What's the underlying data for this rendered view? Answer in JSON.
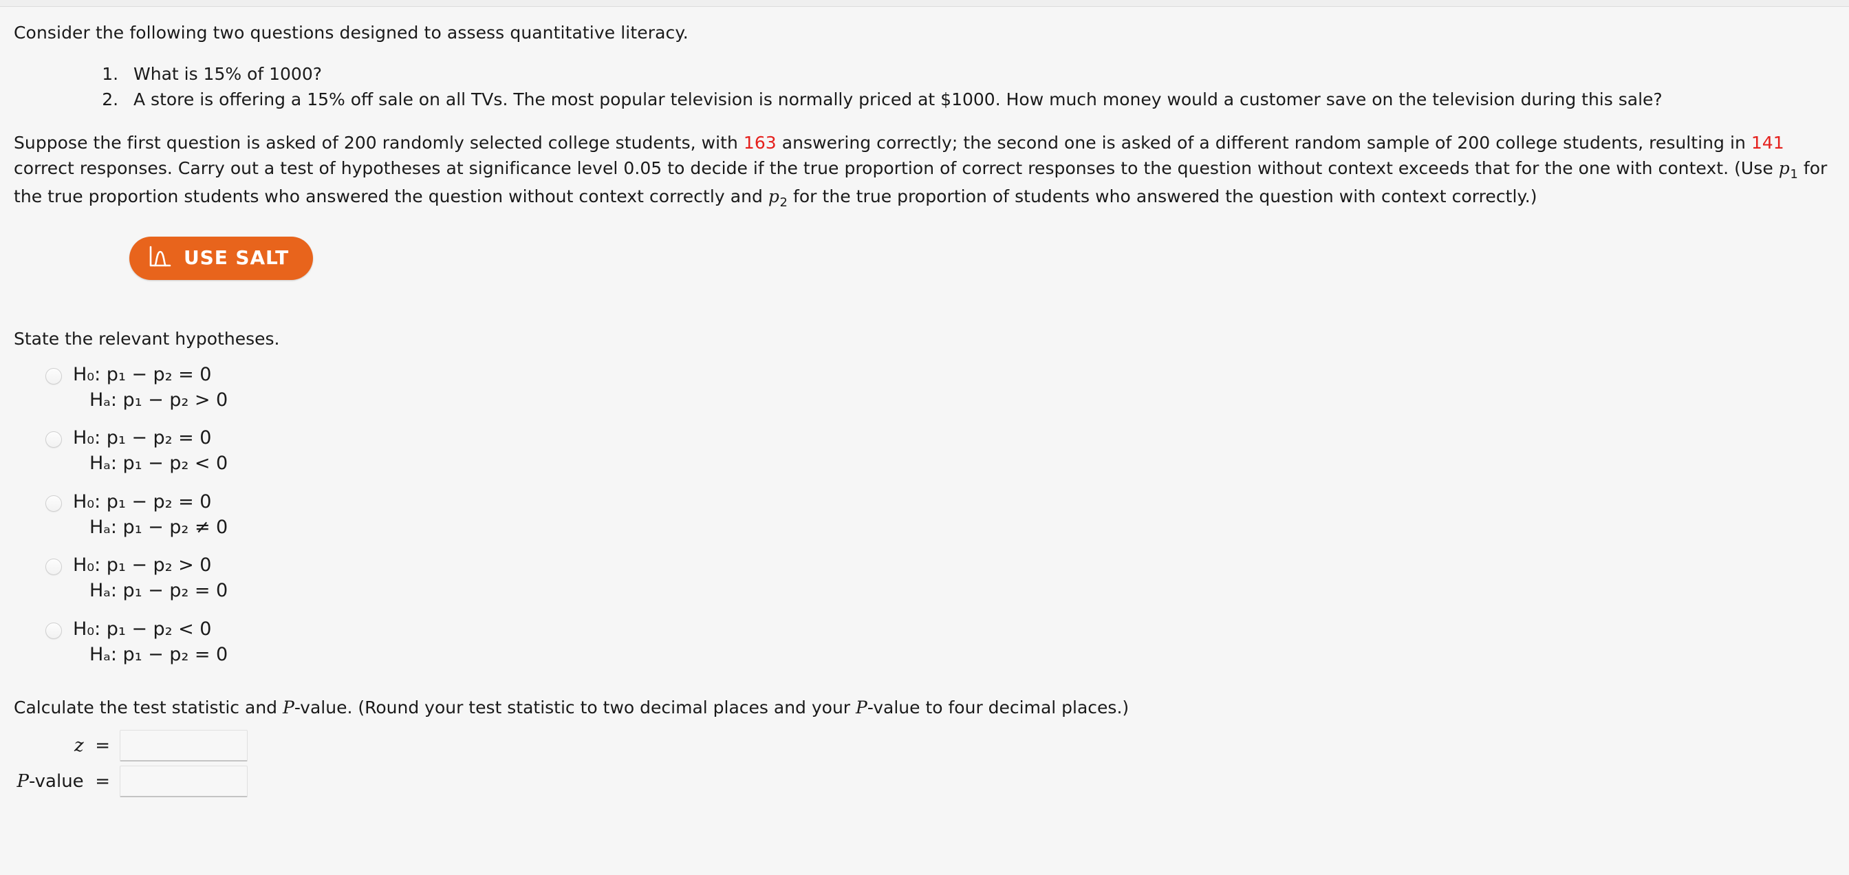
{
  "intro": "Consider the following two questions designed to assess quantitative literacy.",
  "questions": [
    "What is 15% of 1000?",
    "A store is offering a 15% off sale on all TVs. The most popular television is normally priced at $1000. How much money would a customer save on the television during this sale?"
  ],
  "problem": {
    "part1": "Suppose the first question is asked of 200 randomly selected college students, with ",
    "n1_correct": "163",
    "part2": " answering correctly; the second one is asked of a different random sample of 200 college students, resulting in ",
    "n2_correct": "141",
    "part3": " correct responses. Carry out a test of hypotheses at significance level 0.05 to decide if the true proportion of correct responses to the question without context exceeds that for the one with context. (Use ",
    "var1": "p",
    "var1_sub": "1",
    "part4": " for the true proportion students who answered the question without context correctly and ",
    "var2": "p",
    "var2_sub": "2",
    "part5": " for the true proportion of students who answered the question with context correctly.)"
  },
  "salt": {
    "label": "USE SALT",
    "icon": "distribution-curve-icon",
    "color": "#e8641c"
  },
  "hypotheses": {
    "prompt": "State the relevant hypotheses.",
    "options": [
      {
        "null": "H₀: p₁ − p₂ = 0",
        "alt": "Hₐ: p₁ − p₂ > 0",
        "selected": false
      },
      {
        "null": "H₀: p₁ − p₂ = 0",
        "alt": "Hₐ: p₁ − p₂ < 0",
        "selected": false
      },
      {
        "null": "H₀: p₁ − p₂ = 0",
        "alt": "Hₐ: p₁ − p₂ ≠ 0",
        "selected": false
      },
      {
        "null": "H₀: p₁ − p₂ > 0",
        "alt": "Hₐ: p₁ − p₂ = 0",
        "selected": false
      },
      {
        "null": "H₀: p₁ − p₂ < 0",
        "alt": "Hₐ: p₁ − p₂ = 0",
        "selected": false
      }
    ]
  },
  "calculate": {
    "prompt_part1": "Calculate the test statistic and ",
    "prompt_P": "P",
    "prompt_part2": "-value. (Round your test statistic to two decimal places and your ",
    "prompt_P2": "P",
    "prompt_part3": "-value to four decimal places.)",
    "fields": [
      {
        "label_var": "z",
        "label_rest": "",
        "eq": "=",
        "value": "",
        "placeholder": ""
      },
      {
        "label_var": "P",
        "label_rest": "-value",
        "eq": "=",
        "value": "",
        "placeholder": ""
      }
    ]
  },
  "colors": {
    "red": "#e5201c",
    "orange": "#e8641c",
    "background": "#f6f6f6"
  }
}
